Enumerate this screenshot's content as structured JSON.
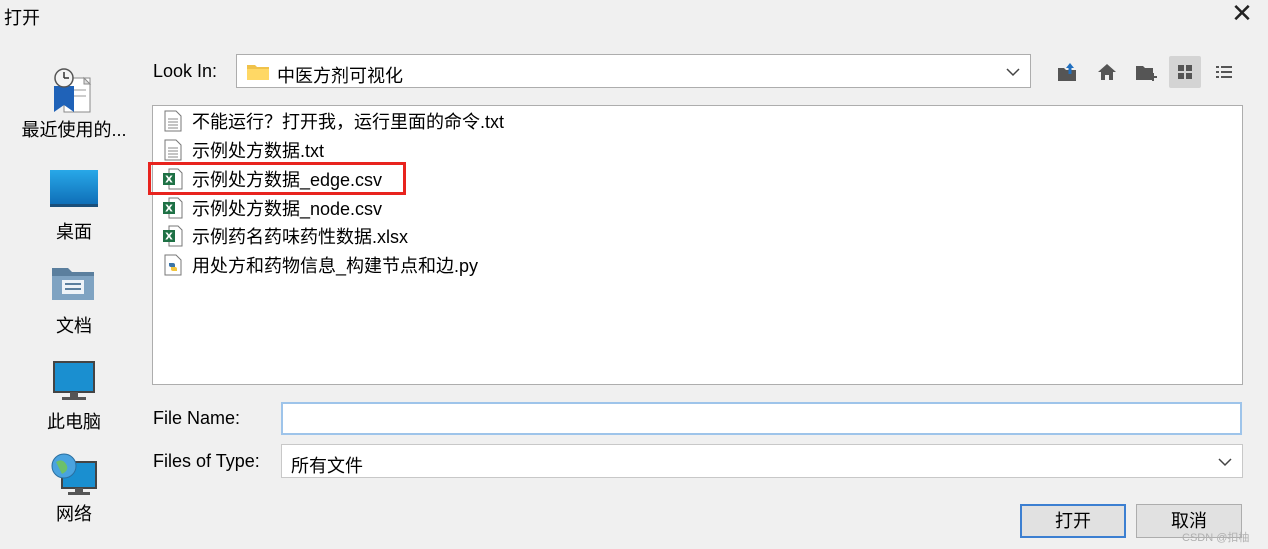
{
  "window": {
    "title": "打开"
  },
  "places": [
    {
      "label": "最近使用的...",
      "icon": "recent-items-icon"
    },
    {
      "label": "桌面",
      "icon": "desktop-icon"
    },
    {
      "label": "文档",
      "icon": "documents-icon"
    },
    {
      "label": "此电脑",
      "icon": "this-pc-icon"
    },
    {
      "label": "网络",
      "icon": "network-icon"
    }
  ],
  "look_in": {
    "label": "Look In:",
    "value": "中医方剂可视化"
  },
  "toolbar": {
    "up_icon": "up-folder-icon",
    "home_icon": "home-icon",
    "new_folder_icon": "new-folder-icon",
    "list_view_icon": "list-view-icon",
    "details_view_icon": "details-view-icon"
  },
  "files": [
    {
      "name": "不能运行？打开我，运行里面的命令.txt",
      "type": "text-file-icon"
    },
    {
      "name": "示例处方数据.txt",
      "type": "text-file-icon"
    },
    {
      "name": "示例处方数据_edge.csv",
      "type": "excel-file-icon"
    },
    {
      "name": "示例处方数据_node.csv",
      "type": "excel-file-icon"
    },
    {
      "name": "示例药名药味药性数据.xlsx",
      "type": "excel-file-icon"
    },
    {
      "name": "用处方和药物信息_构建节点和边.py",
      "type": "python-file-icon"
    }
  ],
  "file_name": {
    "label": "File Name:",
    "value": ""
  },
  "file_type": {
    "label": "Files of Type:",
    "value": "所有文件"
  },
  "buttons": {
    "open": "打开",
    "cancel": "取消"
  },
  "watermark": "CSDN @扣柚",
  "colors": {
    "highlight_box": "#e8231e",
    "input_focus": "#9ec4ea",
    "default_button_border": "#3c7fd1"
  }
}
